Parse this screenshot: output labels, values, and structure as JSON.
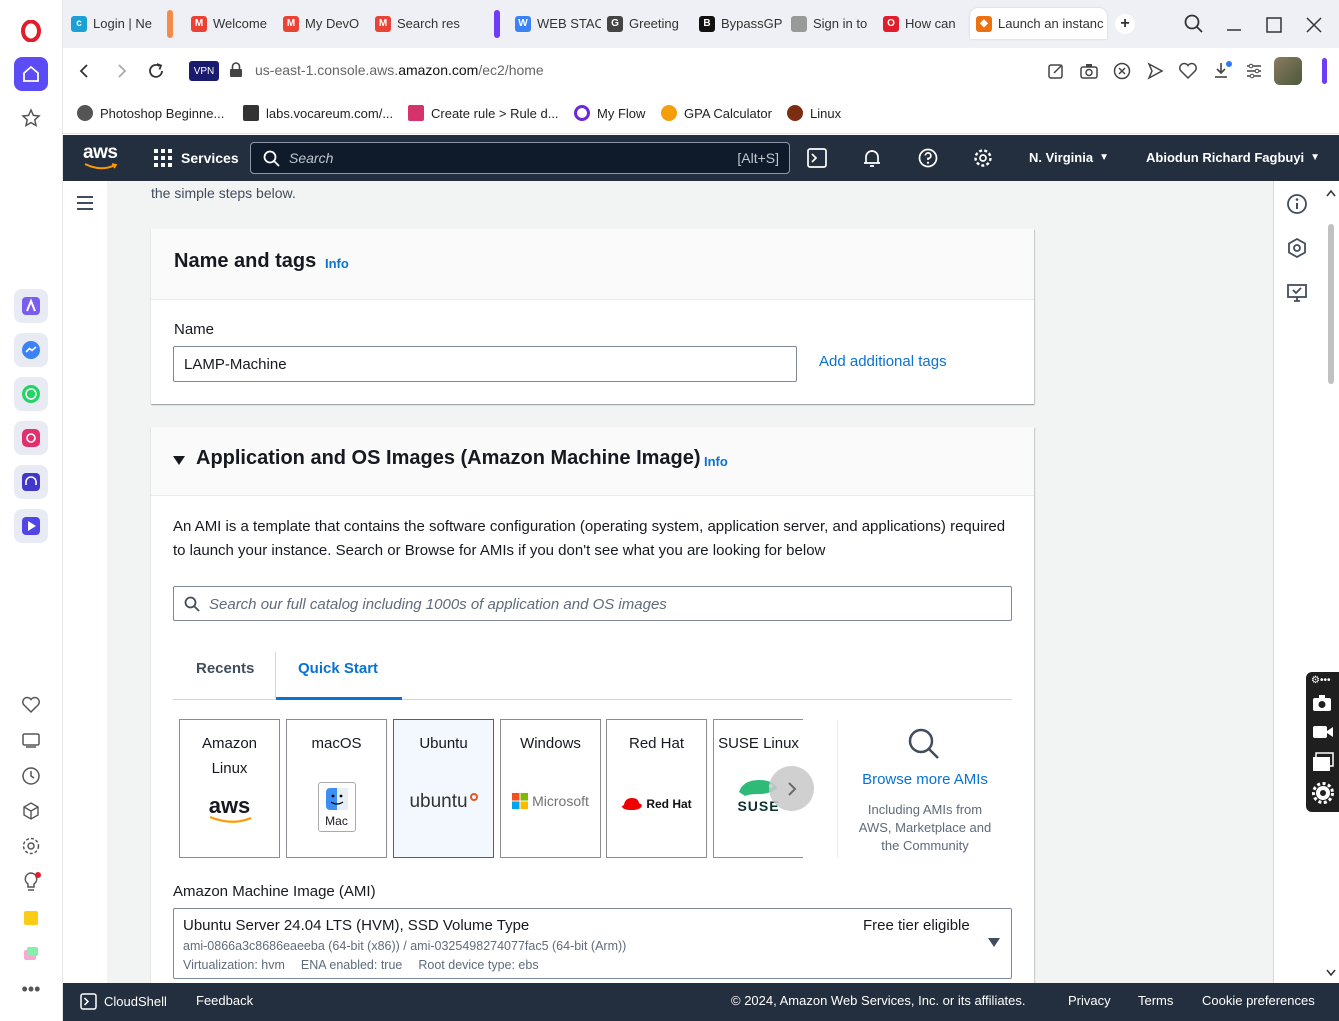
{
  "browser": {
    "tabs": [
      {
        "label": "Login | Ne",
        "fav_color": "#1ba0d7",
        "fav_glyph": "c"
      },
      {
        "label": "Welcome",
        "fav_color": "#ea4335",
        "fav_glyph": "M"
      },
      {
        "label": "My DevO",
        "fav_color": "#ea4335",
        "fav_glyph": "M"
      },
      {
        "label": "Search res",
        "fav_color": "#ea4335",
        "fav_glyph": "M"
      },
      {
        "label": "WEB STAC",
        "fav_color": "#3b82f6",
        "fav_glyph": "W"
      },
      {
        "label": "Greeting",
        "fav_color": "#444444",
        "fav_glyph": "G"
      },
      {
        "label": "BypassGP",
        "fav_color": "#111111",
        "fav_glyph": "B"
      },
      {
        "label": "Sign in to",
        "fav_color": "#999999",
        "fav_glyph": ""
      },
      {
        "label": "How can",
        "fav_color": "#e11d2b",
        "fav_glyph": "O"
      },
      {
        "label": "Launch an instanc",
        "fav_color": "#ec7211",
        "fav_glyph": "◆"
      }
    ],
    "vpn_label": "VPN",
    "url_prefix": "us-east-1.console.aws.",
    "url_domain": "amazon.com",
    "url_path": "/ec2/home",
    "bookmarks": [
      {
        "label": "Photoshop Beginne...",
        "color": "#555555"
      },
      {
        "label": "labs.vocareum.com/...",
        "color": "#333333"
      },
      {
        "label": "Create rule > Rule d...",
        "color": "#d6336c"
      },
      {
        "label": "My Flow",
        "color": "#6d28d9"
      },
      {
        "label": "GPA Calculator",
        "color": "#f59e0b"
      },
      {
        "label": "Linux",
        "color": "#7c2d12"
      }
    ]
  },
  "aws_nav": {
    "logo": "aws",
    "services": "Services",
    "search_placeholder": "Search",
    "search_shortcut": "[Alt+S]",
    "region": "N. Virginia",
    "user": "Abiodun Richard Fagbuyi"
  },
  "page": {
    "intro_tail": "the simple steps below.",
    "name_tags": {
      "title": "Name and tags",
      "info": "Info",
      "name_label": "Name",
      "name_value": "LAMP-Machine",
      "add_tags": "Add additional tags"
    },
    "ami": {
      "title": "Application and OS Images (Amazon Machine Image)",
      "info": "Info",
      "description": "An AMI is a template that contains the software configuration (operating system, application server, and applications) required to launch your instance. Search or Browse for AMIs if you don't see what you are looking for below",
      "search_placeholder": "Search our full catalog including 1000s of application and OS images",
      "tabs": [
        "Recents",
        "Quick Start"
      ],
      "tiles": [
        {
          "name": "Amazon Linux",
          "logo": "aws"
        },
        {
          "name": "macOS",
          "logo": "Mac"
        },
        {
          "name": "Ubuntu",
          "logo": "ubuntu"
        },
        {
          "name": "Windows",
          "logo": "Microsoft"
        },
        {
          "name": "Red Hat",
          "logo": "Red Hat"
        },
        {
          "name": "SUSE Linux",
          "logo": "SUSE"
        }
      ],
      "browse_more": "Browse more AMIs",
      "browse_sub": "Including AMIs from AWS, Marketplace and the Community",
      "ami_label": "Amazon Machine Image (AMI)",
      "selected_ami": "Ubuntu Server 24.04 LTS (HVM), SSD Volume Type",
      "ami_ids": "ami-0866a3c8686eaeeba (64-bit (x86)) / ami-0325498274077fac5 (64-bit (Arm))",
      "virt": "Virtualization: hvm",
      "ena": "ENA enabled: true",
      "root": "Root device type: ebs",
      "free_tier": "Free tier eligible"
    }
  },
  "footer": {
    "cloudshell": "CloudShell",
    "feedback": "Feedback",
    "copyright": "© 2024, Amazon Web Services, Inc. or its affiliates.",
    "privacy": "Privacy",
    "terms": "Terms",
    "cookies": "Cookie preferences"
  },
  "colors": {
    "aws_nav": "#232f3e",
    "link": "#0972d3",
    "opera_red": "#e11d2b",
    "selected_tile": "#f2f8fd"
  }
}
